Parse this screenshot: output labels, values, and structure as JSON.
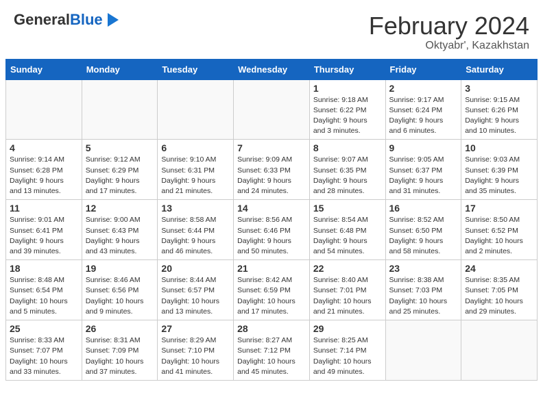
{
  "header": {
    "logo_general": "General",
    "logo_blue": "Blue",
    "month_year": "February 2024",
    "location": "Oktyabr', Kazakhstan"
  },
  "days_of_week": [
    "Sunday",
    "Monday",
    "Tuesday",
    "Wednesday",
    "Thursday",
    "Friday",
    "Saturday"
  ],
  "weeks": [
    [
      {
        "day": "",
        "info": ""
      },
      {
        "day": "",
        "info": ""
      },
      {
        "day": "",
        "info": ""
      },
      {
        "day": "",
        "info": ""
      },
      {
        "day": "1",
        "info": "Sunrise: 9:18 AM\nSunset: 6:22 PM\nDaylight: 9 hours\nand 3 minutes."
      },
      {
        "day": "2",
        "info": "Sunrise: 9:17 AM\nSunset: 6:24 PM\nDaylight: 9 hours\nand 6 minutes."
      },
      {
        "day": "3",
        "info": "Sunrise: 9:15 AM\nSunset: 6:26 PM\nDaylight: 9 hours\nand 10 minutes."
      }
    ],
    [
      {
        "day": "4",
        "info": "Sunrise: 9:14 AM\nSunset: 6:28 PM\nDaylight: 9 hours\nand 13 minutes."
      },
      {
        "day": "5",
        "info": "Sunrise: 9:12 AM\nSunset: 6:29 PM\nDaylight: 9 hours\nand 17 minutes."
      },
      {
        "day": "6",
        "info": "Sunrise: 9:10 AM\nSunset: 6:31 PM\nDaylight: 9 hours\nand 21 minutes."
      },
      {
        "day": "7",
        "info": "Sunrise: 9:09 AM\nSunset: 6:33 PM\nDaylight: 9 hours\nand 24 minutes."
      },
      {
        "day": "8",
        "info": "Sunrise: 9:07 AM\nSunset: 6:35 PM\nDaylight: 9 hours\nand 28 minutes."
      },
      {
        "day": "9",
        "info": "Sunrise: 9:05 AM\nSunset: 6:37 PM\nDaylight: 9 hours\nand 31 minutes."
      },
      {
        "day": "10",
        "info": "Sunrise: 9:03 AM\nSunset: 6:39 PM\nDaylight: 9 hours\nand 35 minutes."
      }
    ],
    [
      {
        "day": "11",
        "info": "Sunrise: 9:01 AM\nSunset: 6:41 PM\nDaylight: 9 hours\nand 39 minutes."
      },
      {
        "day": "12",
        "info": "Sunrise: 9:00 AM\nSunset: 6:43 PM\nDaylight: 9 hours\nand 43 minutes."
      },
      {
        "day": "13",
        "info": "Sunrise: 8:58 AM\nSunset: 6:44 PM\nDaylight: 9 hours\nand 46 minutes."
      },
      {
        "day": "14",
        "info": "Sunrise: 8:56 AM\nSunset: 6:46 PM\nDaylight: 9 hours\nand 50 minutes."
      },
      {
        "day": "15",
        "info": "Sunrise: 8:54 AM\nSunset: 6:48 PM\nDaylight: 9 hours\nand 54 minutes."
      },
      {
        "day": "16",
        "info": "Sunrise: 8:52 AM\nSunset: 6:50 PM\nDaylight: 9 hours\nand 58 minutes."
      },
      {
        "day": "17",
        "info": "Sunrise: 8:50 AM\nSunset: 6:52 PM\nDaylight: 10 hours\nand 2 minutes."
      }
    ],
    [
      {
        "day": "18",
        "info": "Sunrise: 8:48 AM\nSunset: 6:54 PM\nDaylight: 10 hours\nand 5 minutes."
      },
      {
        "day": "19",
        "info": "Sunrise: 8:46 AM\nSunset: 6:56 PM\nDaylight: 10 hours\nand 9 minutes."
      },
      {
        "day": "20",
        "info": "Sunrise: 8:44 AM\nSunset: 6:57 PM\nDaylight: 10 hours\nand 13 minutes."
      },
      {
        "day": "21",
        "info": "Sunrise: 8:42 AM\nSunset: 6:59 PM\nDaylight: 10 hours\nand 17 minutes."
      },
      {
        "day": "22",
        "info": "Sunrise: 8:40 AM\nSunset: 7:01 PM\nDaylight: 10 hours\nand 21 minutes."
      },
      {
        "day": "23",
        "info": "Sunrise: 8:38 AM\nSunset: 7:03 PM\nDaylight: 10 hours\nand 25 minutes."
      },
      {
        "day": "24",
        "info": "Sunrise: 8:35 AM\nSunset: 7:05 PM\nDaylight: 10 hours\nand 29 minutes."
      }
    ],
    [
      {
        "day": "25",
        "info": "Sunrise: 8:33 AM\nSunset: 7:07 PM\nDaylight: 10 hours\nand 33 minutes."
      },
      {
        "day": "26",
        "info": "Sunrise: 8:31 AM\nSunset: 7:09 PM\nDaylight: 10 hours\nand 37 minutes."
      },
      {
        "day": "27",
        "info": "Sunrise: 8:29 AM\nSunset: 7:10 PM\nDaylight: 10 hours\nand 41 minutes."
      },
      {
        "day": "28",
        "info": "Sunrise: 8:27 AM\nSunset: 7:12 PM\nDaylight: 10 hours\nand 45 minutes."
      },
      {
        "day": "29",
        "info": "Sunrise: 8:25 AM\nSunset: 7:14 PM\nDaylight: 10 hours\nand 49 minutes."
      },
      {
        "day": "",
        "info": ""
      },
      {
        "day": "",
        "info": ""
      }
    ]
  ]
}
